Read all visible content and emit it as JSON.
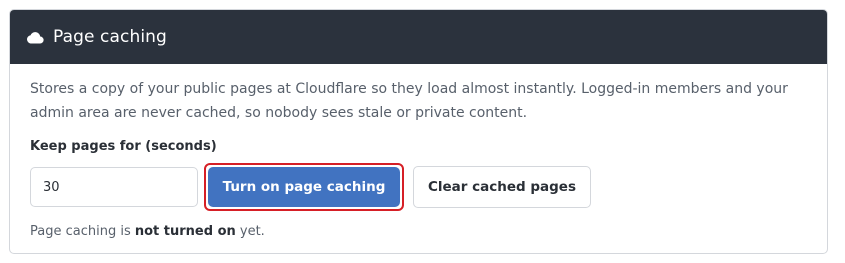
{
  "header": {
    "icon": "cloud-icon",
    "title": "Page caching"
  },
  "body": {
    "description": "Stores a copy of your public pages at Cloudflare so they load almost instantly. Logged-in members and your admin area are never cached, so nobody sees stale or private content.",
    "field_label": "Keep pages for (seconds)",
    "seconds_value": "30",
    "primary_button": "Turn on page caching",
    "secondary_button": "Clear cached pages",
    "status_prefix": "Page caching is ",
    "status_emphasis": "not turned on",
    "status_suffix": " yet."
  },
  "colors": {
    "header_bg": "#2b323d",
    "primary": "#4173c1",
    "highlight": "#d61f26"
  }
}
